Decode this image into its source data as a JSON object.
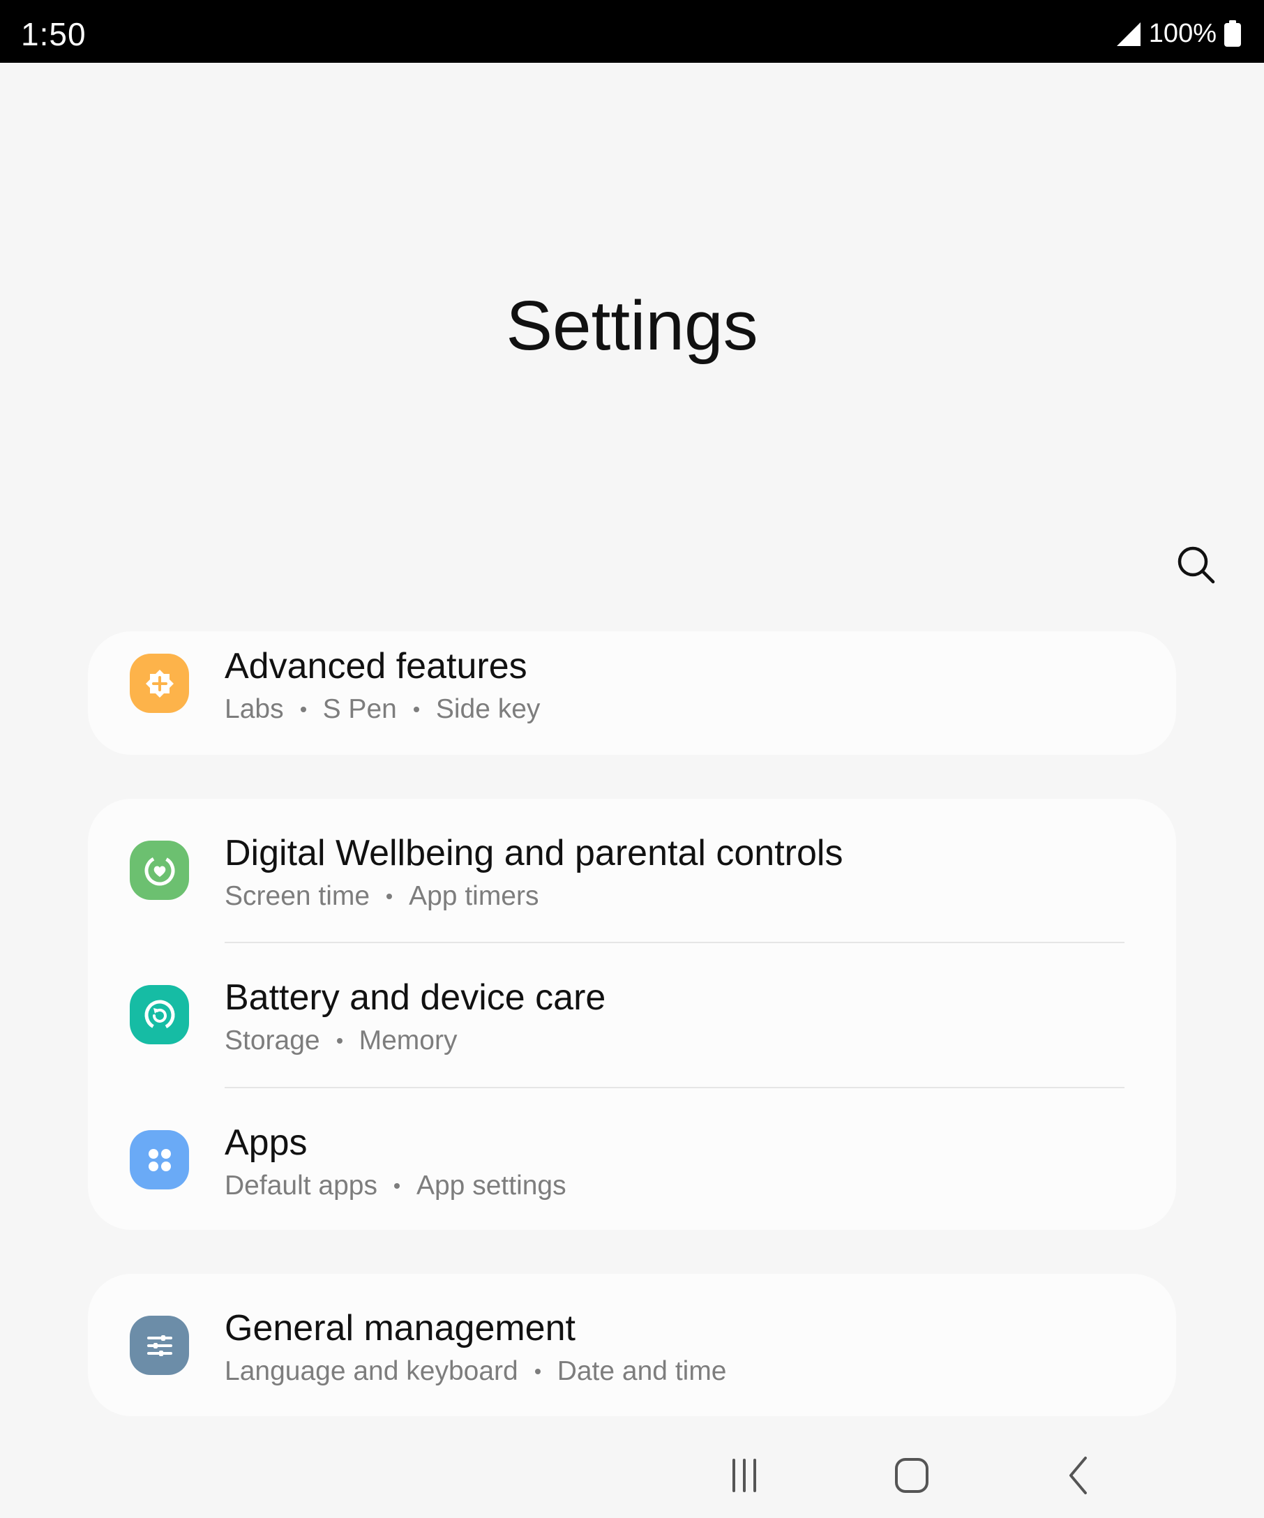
{
  "status_bar": {
    "time": "1:50",
    "battery": "100%"
  },
  "header": {
    "title": "Settings",
    "search_icon": "search-icon"
  },
  "items": [
    {
      "title": "Advanced features",
      "subtitle": [
        "Labs",
        "S Pen",
        "Side key"
      ],
      "icon": "advanced-features-icon",
      "icon_color": "#fdb34a"
    },
    {
      "title": "Digital Wellbeing and parental controls",
      "subtitle": [
        "Screen time",
        "App timers"
      ],
      "icon": "digital-wellbeing-icon",
      "icon_color": "#6cc070"
    },
    {
      "title": "Battery and device care",
      "subtitle": [
        "Storage",
        "Memory"
      ],
      "icon": "device-care-icon",
      "icon_color": "#16bca4"
    },
    {
      "title": "Apps",
      "subtitle": [
        "Default apps",
        "App settings"
      ],
      "icon": "apps-icon",
      "icon_color": "#6aaaf6"
    },
    {
      "title": "General management",
      "subtitle": [
        "Language and keyboard",
        "Date and time"
      ],
      "icon": "general-management-icon",
      "icon_color": "#6c8da8"
    }
  ],
  "nav_bar": {
    "recents_icon": "recents-icon",
    "home_icon": "home-icon",
    "back_icon": "back-icon"
  }
}
